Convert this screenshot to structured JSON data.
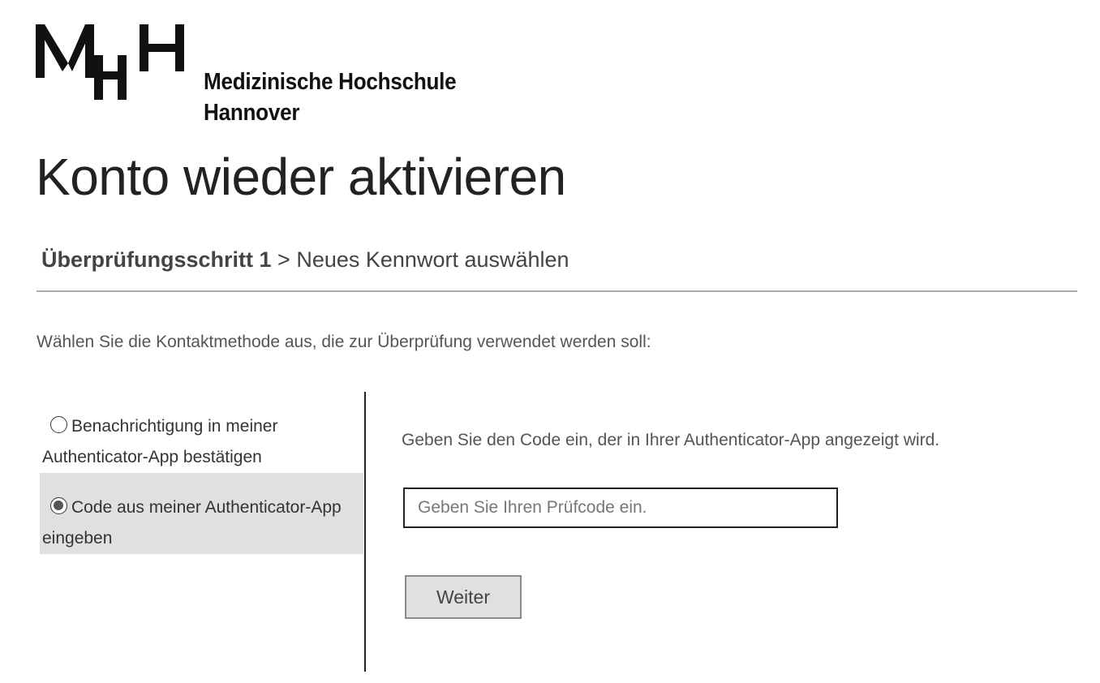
{
  "branding": {
    "logo_icon": "mhh-logo-mark",
    "org_name_line1": "Medizinische Hochschule",
    "org_name_line2": "Hannover"
  },
  "page": {
    "title": "Konto wieder aktivieren"
  },
  "breadcrumb": {
    "active_step": "Überprüfungsschritt 1",
    "separator": ">",
    "next_step": "Neues Kennwort auswählen"
  },
  "instruction": "Wählen Sie die Kontaktmethode aus, die zur Überprüfung verwendet werden soll:",
  "methods": [
    {
      "label": "Benachrichtigung in meiner Authenticator-App bestätigen",
      "selected": false
    },
    {
      "label": "Code aus meiner Authenticator-App eingeben",
      "selected": true
    }
  ],
  "code_panel": {
    "prompt": "Geben Sie den Code ein, der in Ihrer Authenticator-App angezeigt wird.",
    "input_placeholder": "Geben Sie Ihren Prüfcode ein.",
    "input_value": "",
    "next_button_label": "Weiter"
  },
  "colors": {
    "selected_option_bg": "#e0e0e0",
    "divider": "#aaaaaa",
    "button_bg": "#e0e0e0"
  }
}
